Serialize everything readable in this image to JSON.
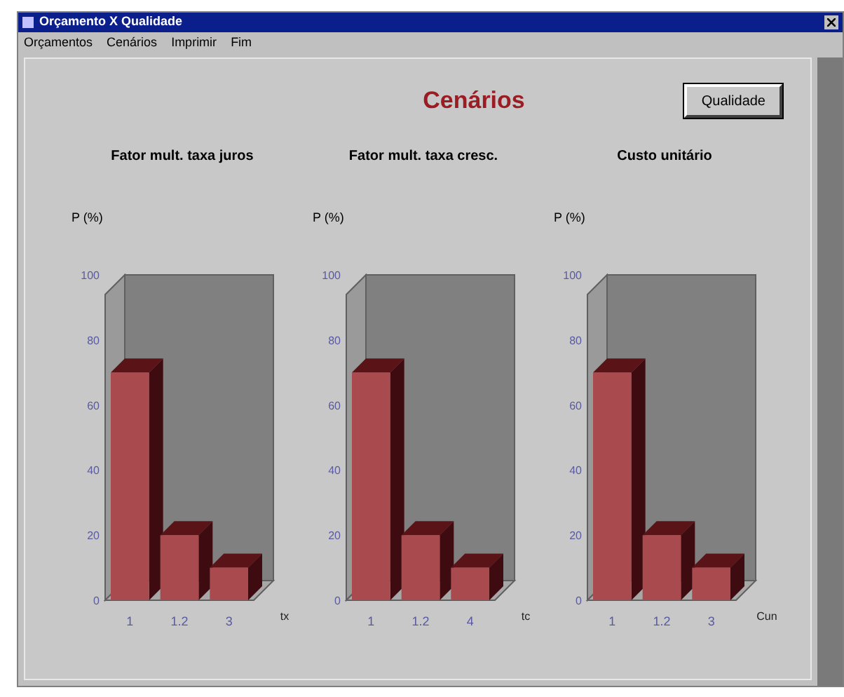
{
  "window": {
    "title": "Orçamento X Qualidade"
  },
  "menu": [
    {
      "label": "Orçamentos"
    },
    {
      "label": "Cenários"
    },
    {
      "label": "Imprimir"
    },
    {
      "label": "Fim"
    }
  ],
  "heading": "Cenários",
  "button": "Qualidade",
  "charts": [
    {
      "chart_data": {
        "type": "bar",
        "title": "Fator mult. taxa juros",
        "ylabel": "P (%)",
        "xlabel": "tx",
        "categories": [
          "1",
          "1.2",
          "3"
        ],
        "values": [
          70,
          20,
          10
        ],
        "ylim": [
          0,
          100
        ],
        "yticks": [
          0,
          20,
          40,
          60,
          80,
          100
        ]
      }
    },
    {
      "chart_data": {
        "type": "bar",
        "title": "Fator mult. taxa cresc.",
        "ylabel": "P (%)",
        "xlabel": "tc",
        "categories": [
          "1",
          "1.2",
          "4"
        ],
        "values": [
          70,
          20,
          10
        ],
        "ylim": [
          0,
          100
        ],
        "yticks": [
          0,
          20,
          40,
          60,
          80,
          100
        ]
      }
    },
    {
      "chart_data": {
        "type": "bar",
        "title": "Custo unitário",
        "ylabel": "P (%)",
        "xlabel": "Cun",
        "categories": [
          "1",
          "1.2",
          "3"
        ],
        "values": [
          70,
          20,
          10
        ],
        "ylim": [
          0,
          100
        ],
        "yticks": [
          0,
          20,
          40,
          60,
          80,
          100
        ]
      }
    }
  ]
}
